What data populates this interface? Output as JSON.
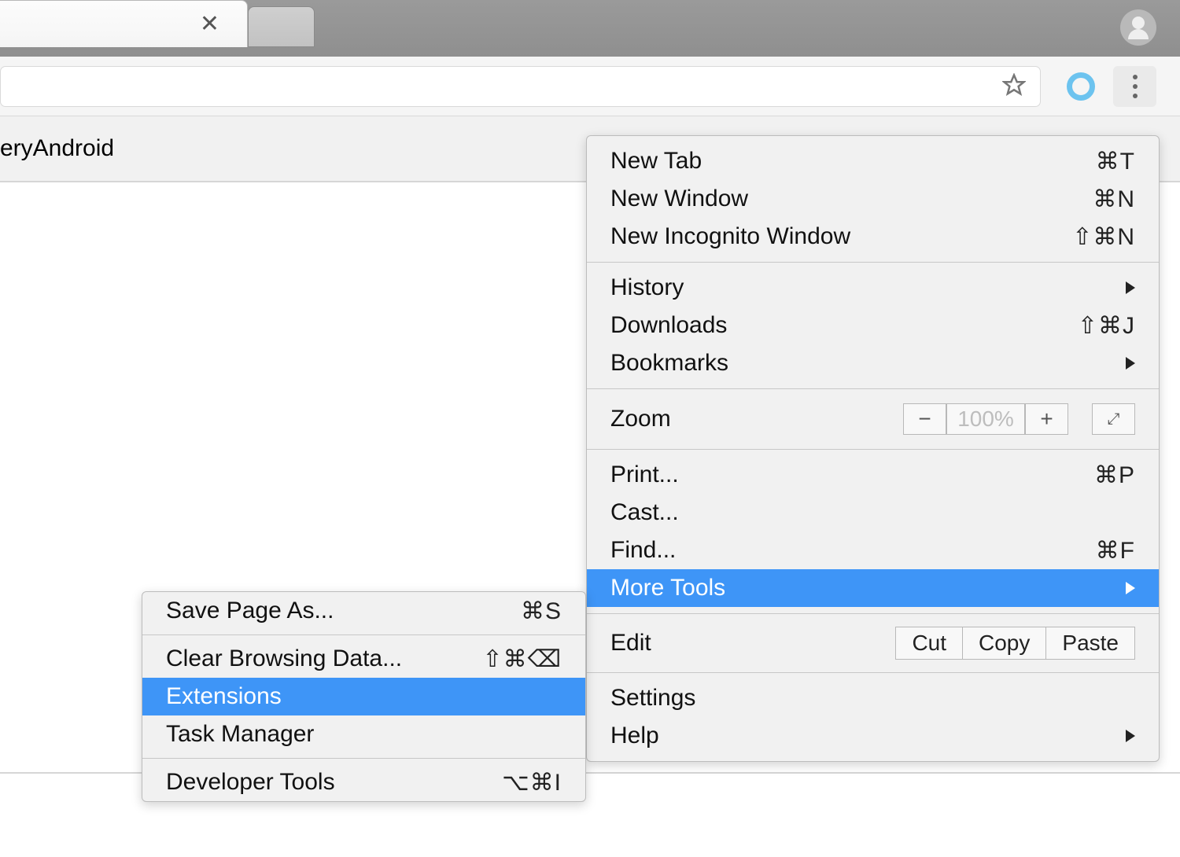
{
  "page": {
    "header_text": "eryAndroid"
  },
  "zoom": {
    "value": "100%",
    "fullscreen_glyph": "⤢"
  },
  "main_menu": {
    "sec1": [
      {
        "label": "New Tab",
        "shortcut": "⌘T"
      },
      {
        "label": "New Window",
        "shortcut": "⌘N"
      },
      {
        "label": "New Incognito Window",
        "shortcut": "⇧⌘N"
      }
    ],
    "sec2": [
      {
        "label": "History",
        "arrow": true
      },
      {
        "label": "Downloads",
        "shortcut": "⇧⌘J"
      },
      {
        "label": "Bookmarks",
        "arrow": true
      }
    ],
    "zoom_label": "Zoom",
    "sec4": [
      {
        "label": "Print...",
        "shortcut": "⌘P"
      },
      {
        "label": "Cast..."
      },
      {
        "label": "Find...",
        "shortcut": "⌘F"
      },
      {
        "label": "More Tools",
        "arrow": true,
        "selected": true
      }
    ],
    "edit_label": "Edit",
    "edit_buttons": [
      "Cut",
      "Copy",
      "Paste"
    ],
    "sec6": [
      {
        "label": "Settings"
      },
      {
        "label": "Help",
        "arrow": true
      }
    ]
  },
  "sub_menu": {
    "items": [
      {
        "label": "Save Page As...",
        "shortcut": "⌘S"
      },
      {
        "sep": true
      },
      {
        "label": "Clear Browsing Data...",
        "shortcut": "⇧⌘⌫"
      },
      {
        "label": "Extensions",
        "selected": true
      },
      {
        "label": "Task Manager"
      },
      {
        "sep": true
      },
      {
        "label": "Developer Tools",
        "shortcut": "⌥⌘I"
      }
    ]
  }
}
